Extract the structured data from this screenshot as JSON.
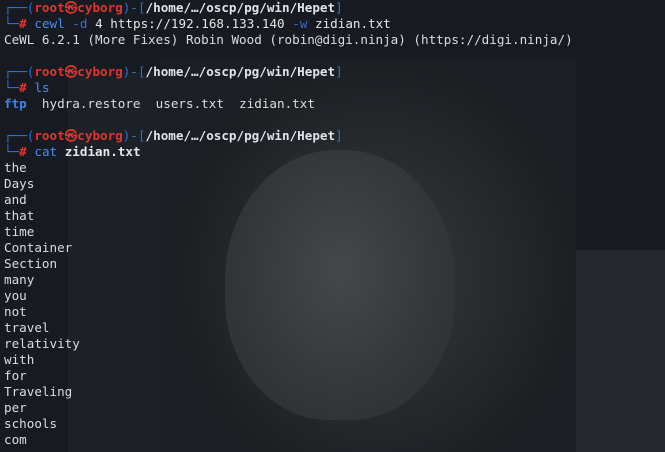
{
  "prompt": {
    "user": "root",
    "skull": "㉿",
    "host": "cyborg",
    "path": "/home/…/oscp/pg/win/Hepet",
    "symbol": "#"
  },
  "commands": [
    {
      "name": "cewl",
      "flag1": "-d",
      "arg1": "4",
      "arg2": "https://192.168.133.140",
      "flag2": "-w",
      "arg3": "zidian.txt"
    },
    {
      "name": "ls"
    },
    {
      "name": "cat",
      "arg1": "zidian.txt"
    }
  ],
  "output": {
    "cewl_banner": "CeWL 6.2.1 (More Fixes) Robin Wood (robin@digi.ninja) (https://digi.ninja/)",
    "ls": [
      "ftp",
      "hydra.restore",
      "users.txt",
      "zidian.txt"
    ],
    "words": [
      "the",
      "Days",
      "and",
      "that",
      "time",
      "Container",
      "Section",
      "many",
      "you",
      "not",
      "travel",
      "relativity",
      "with",
      "for",
      "Traveling",
      "per",
      "schools",
      "com"
    ]
  },
  "colors": {
    "prompt_frame": "#2f6fd6",
    "user_host": "#e0352b",
    "command": "#4a8cf0",
    "directory": "#3f83e8"
  }
}
